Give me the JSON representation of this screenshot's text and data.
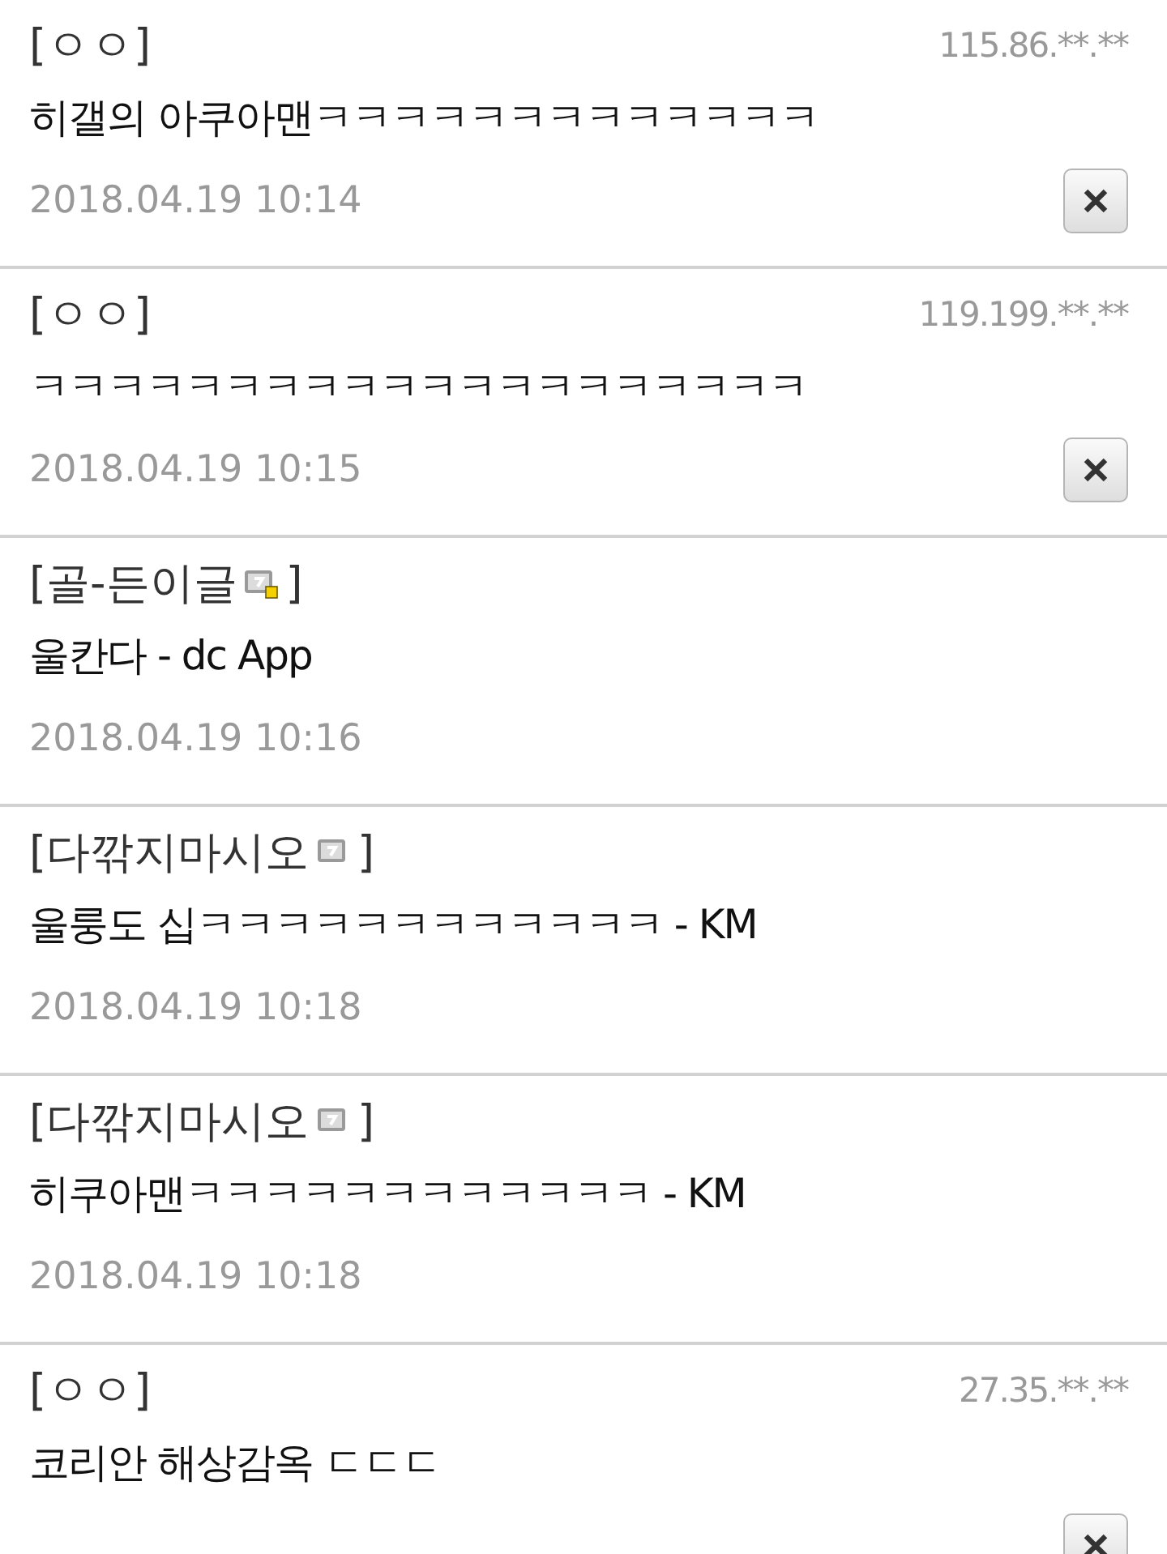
{
  "comments": [
    {
      "kind": "guest",
      "name": "[ㅇㅇ]",
      "ip": "115.86.**.**",
      "text": "히갤의 아쿠아맨ㅋㅋㅋㅋㅋㅋㅋㅋㅋㅋㅋㅋㅋ",
      "date": "2018.04.19 10:14",
      "deletable": true
    },
    {
      "kind": "guest",
      "name": "[ㅇㅇ]",
      "ip": "119.199.**.**",
      "text": "ㅋㅋㅋㅋㅋㅋㅋㅋㅋㅋㅋㅋㅋㅋㅋㅋㅋㅋㅋㅋ",
      "date": "2018.04.19 10:15",
      "deletable": true
    },
    {
      "kind": "member",
      "name": "[골-든이글",
      "name_end": "]",
      "fixed": true,
      "text": "울칸다 - dc App",
      "date": "2018.04.19 10:16",
      "deletable": false
    },
    {
      "kind": "member",
      "name": "[다깎지마시오",
      "name_end": "]",
      "fixed": false,
      "text": "울룽도 십ㅋㅋㅋㅋㅋㅋㅋㅋㅋㅋㅋㅋ - KM",
      "date": "2018.04.19 10:18",
      "deletable": false
    },
    {
      "kind": "member",
      "name": "[다깎지마시오",
      "name_end": "]",
      "fixed": false,
      "text": "히쿠아맨ㅋㅋㅋㅋㅋㅋㅋㅋㅋㅋㅋㅋ - KM",
      "date": "2018.04.19 10:18",
      "deletable": false
    },
    {
      "kind": "guest",
      "name": "[ㅇㅇ]",
      "ip": "27.35.**.**",
      "text": "코리안 해상감옥 ㄷㄷㄷ",
      "deletable": true
    }
  ]
}
